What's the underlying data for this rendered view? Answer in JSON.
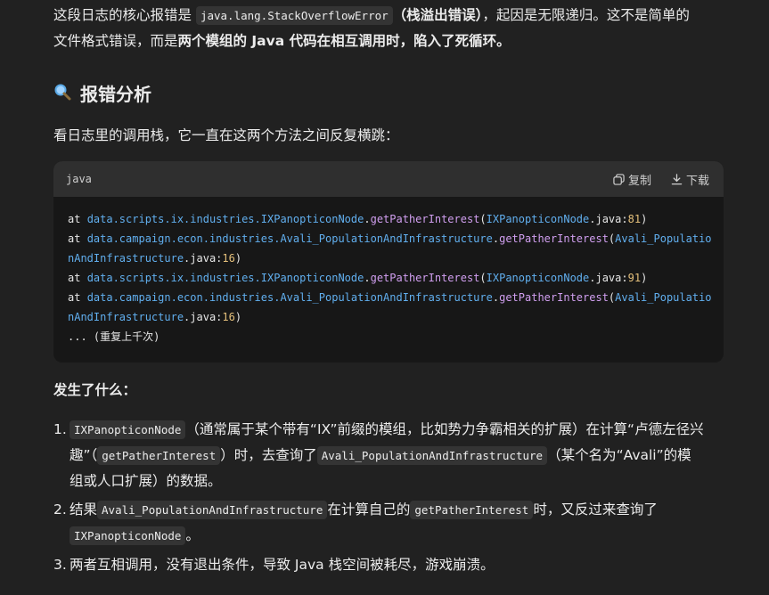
{
  "intro": {
    "line1_a": "这段日志的核心报错是 ",
    "code1": "java.lang.StackOverflowError",
    "line1_b": "（栈溢出错误）",
    "line1_c": "，起因是无限递归。这不是简单的",
    "line2_a": "文件格式错误，而是",
    "line2_b": "两个模组的 Java 代码在相互调用时，陷入了死循环。"
  },
  "section_title": "报错分析",
  "section_icon": "magnifier-icon",
  "lead": "看日志里的调用栈，它一直在这两个方法之间反复横跳：",
  "code_block": {
    "language": "java",
    "copy_label": "复制",
    "download_label": "下载",
    "lines": [
      {
        "at": "at ",
        "pkg": "data.scripts.ix.industries.",
        "cls": "IXPanopticonNode",
        "dot": ".",
        "mth": "getPatherInterest",
        "open": "(",
        "file": "IXPanopticonNode",
        "ext": ".java:",
        "num": "81",
        "close": ")"
      },
      {
        "at": "at ",
        "pkg": "data.campaign.econ.industries.",
        "cls": "Avali_PopulationAndInfrastructure",
        "dot": ".",
        "mth": "getPatherInterest",
        "open": "(",
        "file": "Avali_Populatio",
        "wrap": "nAndInfrastructure",
        "ext": ".java:",
        "num": "16",
        "close": ")"
      },
      {
        "at": "at ",
        "pkg": "data.scripts.ix.industries.",
        "cls": "IXPanopticonNode",
        "dot": ".",
        "mth": "getPatherInterest",
        "open": "(",
        "file": "IXPanopticonNode",
        "ext": ".java:",
        "num": "91",
        "close": ")"
      },
      {
        "at": "at ",
        "pkg": "data.campaign.econ.industries.",
        "cls": "Avali_PopulationAndInfrastructure",
        "dot": ".",
        "mth": "getPatherInterest",
        "open": "(",
        "file": "Avali_Populatio",
        "wrap": "nAndInfrastructure",
        "ext": ".java:",
        "num": "16",
        "close": ")"
      }
    ],
    "tail": "... (重复上千次)"
  },
  "what_happened_title": "发生了什么：",
  "items": [
    {
      "num": "1.",
      "code_a": "IXPanopticonNode",
      "text_a": "（通常属于某个带有“IX”前缀的模组，比如势力争霸相关的扩展）在计算“卢德左径兴",
      "text_b": "趣”（",
      "code_b": "getPatherInterest",
      "text_c": "）时，去查询了",
      "code_c": "Avali_PopulationAndInfrastructure",
      "text_d": "（某个名为“Avali”的模",
      "text_e": "组或人口扩展）的数据。"
    },
    {
      "num": "2.",
      "text_a": "结果",
      "code_a": "Avali_PopulationAndInfrastructure",
      "text_b": "在计算自己的",
      "code_b": "getPatherInterest",
      "text_c": "时，又反过来查询了",
      "code_c": "IXPanopticonNode",
      "text_d": "。"
    },
    {
      "num": "3.",
      "text_a": "两者互相调用，没有退出条件，导致 Java 栈空间被耗尽，游戏崩溃。"
    }
  ]
}
